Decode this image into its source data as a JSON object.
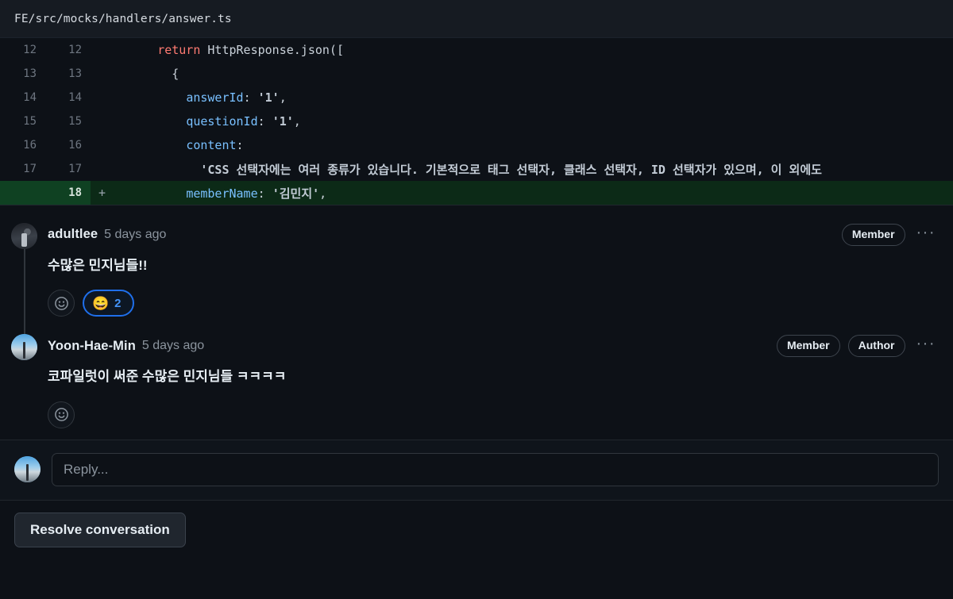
{
  "file": {
    "path": "FE/src/mocks/handlers/answer.ts"
  },
  "diff": {
    "rows": [
      {
        "old": "12",
        "new": "12",
        "marker": "",
        "added": false,
        "tokens": [
          {
            "t": "      ",
            "c": "k-punc"
          },
          {
            "t": "return",
            "c": "k-return"
          },
          {
            "t": " HttpResponse.json([",
            "c": "k-ident"
          }
        ]
      },
      {
        "old": "13",
        "new": "13",
        "marker": "",
        "added": false,
        "tokens": [
          {
            "t": "        {",
            "c": "k-punc"
          }
        ]
      },
      {
        "old": "14",
        "new": "14",
        "marker": "",
        "added": false,
        "tokens": [
          {
            "t": "          ",
            "c": "k-punc"
          },
          {
            "t": "answerId",
            "c": "k-prop"
          },
          {
            "t": ": ",
            "c": "k-punc"
          },
          {
            "t": "'1'",
            "c": "k-str"
          },
          {
            "t": ",",
            "c": "k-punc"
          }
        ]
      },
      {
        "old": "15",
        "new": "15",
        "marker": "",
        "added": false,
        "tokens": [
          {
            "t": "          ",
            "c": "k-punc"
          },
          {
            "t": "questionId",
            "c": "k-prop"
          },
          {
            "t": ": ",
            "c": "k-punc"
          },
          {
            "t": "'1'",
            "c": "k-str"
          },
          {
            "t": ",",
            "c": "k-punc"
          }
        ]
      },
      {
        "old": "16",
        "new": "16",
        "marker": "",
        "added": false,
        "tokens": [
          {
            "t": "          ",
            "c": "k-punc"
          },
          {
            "t": "content",
            "c": "k-prop"
          },
          {
            "t": ":",
            "c": "k-punc"
          }
        ]
      },
      {
        "old": "17",
        "new": "17",
        "marker": "",
        "added": false,
        "tokens": [
          {
            "t": "            ",
            "c": "k-punc"
          },
          {
            "t": "'CSS 선택자에는 여러 종류가 있습니다. 기본적으로 태그 선택자, 클래스 선택자, ID 선택자가 있으며, 이 외에도",
            "c": "k-str-ko"
          }
        ]
      },
      {
        "old": "",
        "new": "18",
        "marker": "+",
        "added": true,
        "tokens": [
          {
            "t": "          ",
            "c": "k-punc"
          },
          {
            "t": "memberName",
            "c": "k-prop"
          },
          {
            "t": ": ",
            "c": "k-punc"
          },
          {
            "t": "'김민지'",
            "c": "k-str"
          },
          {
            "t": ",",
            "c": "k-punc"
          }
        ]
      }
    ]
  },
  "comments": [
    {
      "author": "adultlee",
      "time": "5 days ago",
      "text": "수많은 민지님들!!",
      "badges": [
        "Member"
      ],
      "kebab": "···",
      "avatar_style": "av-dark",
      "reactions": [
        {
          "emoji": "😄",
          "count": "2",
          "active": true
        }
      ]
    },
    {
      "author": "Yoon-Hae-Min",
      "time": "5 days ago",
      "text": "코파일럿이 써준 수많은 민지님들 ㅋㅋㅋㅋ",
      "badges": [
        "Member",
        "Author"
      ],
      "kebab": "···",
      "avatar_style": "av-sky",
      "reactions": []
    }
  ],
  "reply": {
    "placeholder": "Reply...",
    "value": ""
  },
  "footer": {
    "resolve_label": "Resolve conversation"
  },
  "colors": {
    "accent_blue": "#2f81f7",
    "added_green_bg": "#0c2a17",
    "added_green_gutter": "#0f4122",
    "keyword_orange": "#ff7b72",
    "property_blue": "#79c0ff",
    "page_bg": "#0d1117",
    "header_bg": "#161b22"
  }
}
